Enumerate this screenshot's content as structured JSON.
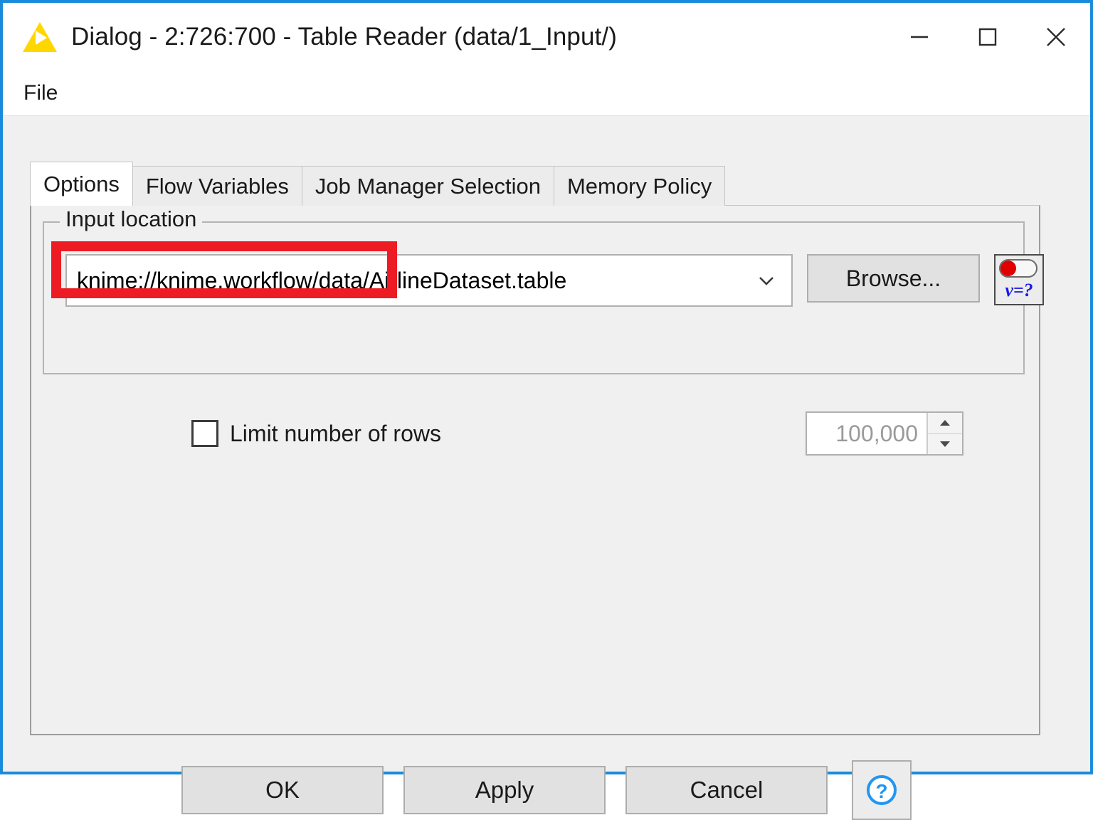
{
  "window": {
    "title": "Dialog - 2:726:700 - Table Reader (data/1_Input/)",
    "logo_icon": "knime-triangle-icon",
    "controls": {
      "minimize": "minimize-icon",
      "maximize": "maximize-icon",
      "close": "close-icon"
    },
    "border_color": "#1a8bdb"
  },
  "menubar": {
    "items": [
      {
        "label": "File"
      }
    ]
  },
  "tabs": [
    {
      "label": "Options",
      "active": true
    },
    {
      "label": "Flow Variables",
      "active": false
    },
    {
      "label": "Job Manager Selection",
      "active": false
    },
    {
      "label": "Memory Policy",
      "active": false
    }
  ],
  "options_tab": {
    "group": {
      "title": "Input location",
      "path_combo": {
        "value": "knime://knime.workflow/data/AirlineDataset.table",
        "arrow_icon": "chevron-down-icon"
      },
      "browse_label": "Browse...",
      "flow_variable_button": {
        "icon": "flow-variable-icon",
        "glyph": "v=?",
        "dot_color": "#e00000",
        "glyph_color": "#1a1ae6"
      }
    },
    "limit_rows": {
      "checked": false,
      "label": "Limit number of rows",
      "value": "100,000",
      "spinner_up_icon": "spinner-up-arrow-icon",
      "spinner_down_icon": "spinner-down-arrow-icon"
    }
  },
  "annotation": {
    "type": "red-highlight-box",
    "color": "#ed1c24",
    "covers_text": "knime://knime.workflow/data/"
  },
  "footer": {
    "buttons": [
      {
        "label": "OK"
      },
      {
        "label": "Apply"
      },
      {
        "label": "Cancel"
      }
    ],
    "help": {
      "icon": "help-question-icon",
      "glyph": "?",
      "color": "#2196f3"
    }
  }
}
